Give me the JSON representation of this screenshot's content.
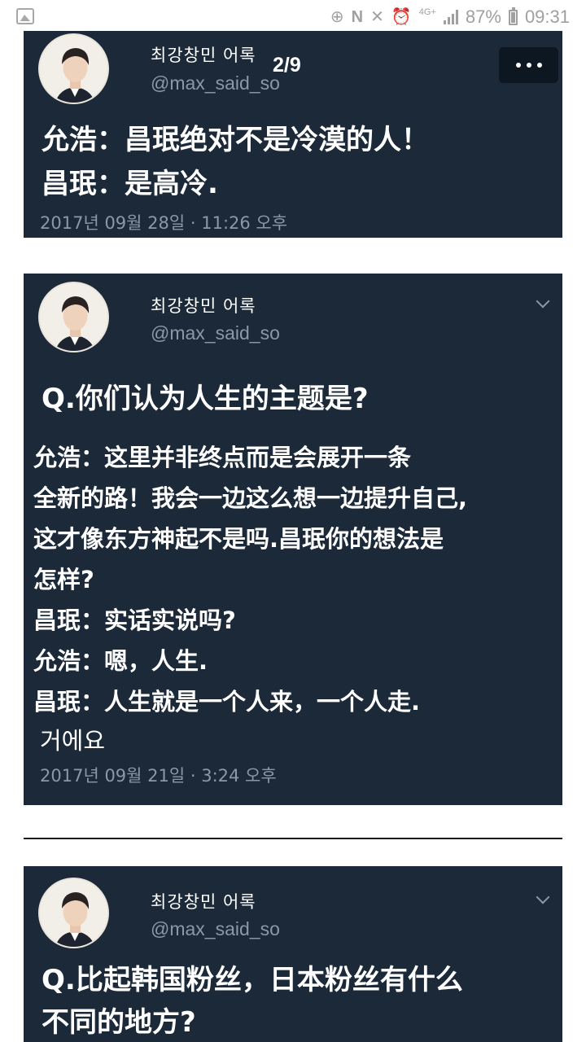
{
  "status_bar": {
    "battery": "87%",
    "time": "09:31",
    "network": "4G+"
  },
  "viewer": {
    "page_indicator": "2/9"
  },
  "tweets": [
    {
      "display_name": "최강창민 어록",
      "handle": "@max_said_so",
      "lines": [
        "允浩：昌珉绝对不是冷漠的人！",
        "昌珉：是高冷."
      ],
      "timestamp": "2017년 09월 28일 · 11:26 오후"
    },
    {
      "display_name": "최강창민 어록",
      "handle": "@max_said_so",
      "question": "Q.你们认为人生的主题是?",
      "lines": [
        "允浩：这里并非终点而是会展开一条",
        "全新的路！我会一边这么想一边提升自己,",
        "这才像东方神起不是吗.昌珉你的想法是",
        "怎样?",
        "昌珉：实话实说吗?",
        "允浩：嗯，人生.",
        "昌珉：人生就是一个人来，一个人走.",
        "거에요"
      ],
      "timestamp": "2017년 09월 21일 · 3:24 오후"
    },
    {
      "display_name": "최강창민 어록",
      "handle": "@max_said_so",
      "question_lines": [
        "Q.比起韩国粉丝，日本粉丝有什么",
        "不同的地方?"
      ]
    }
  ],
  "icons": {
    "status_left": "image-icon",
    "more": "more-options-icon",
    "tweet_menu": "chevron-down-icon"
  },
  "colors": {
    "card_background": "#1c2939",
    "muted_text": "#8b98a5",
    "page_background": "#ffffff"
  }
}
